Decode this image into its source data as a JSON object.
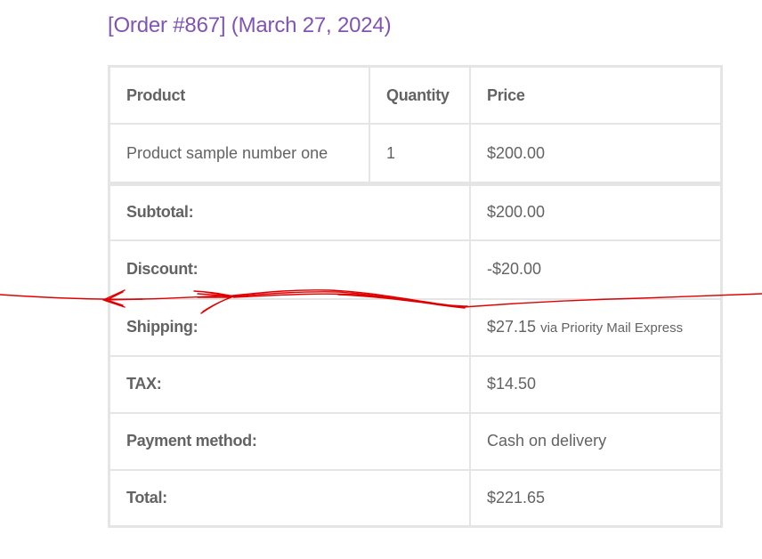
{
  "order": {
    "title": "[Order #867] (March 27, 2024)"
  },
  "table": {
    "headers": {
      "product": "Product",
      "quantity": "Quantity",
      "price": "Price"
    },
    "items": [
      {
        "product": "Product sample number one",
        "quantity": "1",
        "price": "$200.00"
      }
    ],
    "totals": {
      "subtotal": {
        "label": "Subtotal:",
        "value": "$200.00"
      },
      "discount": {
        "label": "Discount:",
        "value": "-$20.00"
      },
      "shipping": {
        "label": "Shipping:",
        "value": "$27.15",
        "method": "via Priority Mail Express"
      },
      "tax": {
        "label": "TAX:",
        "value": "$14.50"
      },
      "payment_method": {
        "label": "Payment method:",
        "value": "Cash on delivery"
      },
      "total": {
        "label": "Total:",
        "value": "$221.65"
      }
    }
  },
  "colors": {
    "title": "#7f54b3",
    "text": "#636363",
    "border": "#e5e5e5",
    "annotation": "#e00000"
  }
}
